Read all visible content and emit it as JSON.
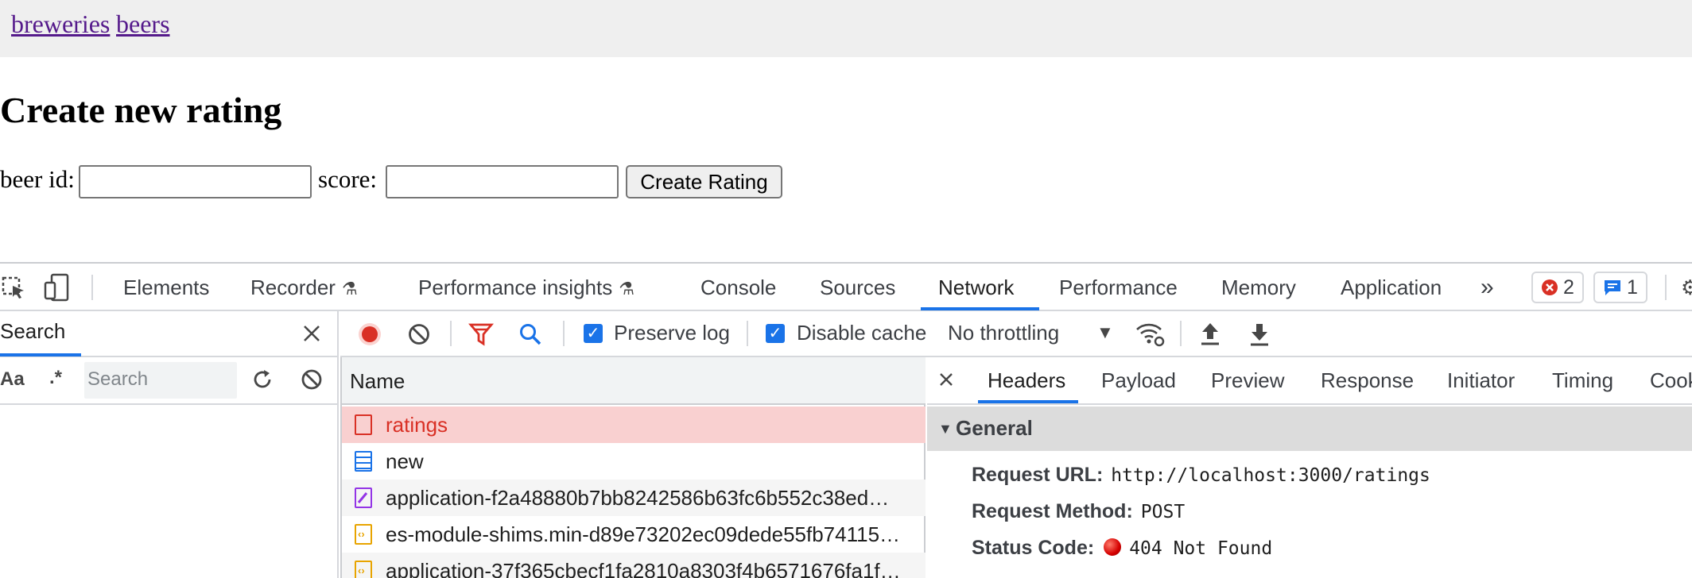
{
  "page": {
    "nav_links": [
      "breweries",
      "beers"
    ],
    "title": "Create new rating",
    "form": {
      "beer_id_label": "beer id:",
      "score_label": "score:",
      "beer_id_value": "",
      "score_value": "",
      "submit_label": "Create Rating"
    }
  },
  "devtools": {
    "tabs": [
      "Elements",
      "Recorder",
      "Performance insights",
      "Console",
      "Sources",
      "Network",
      "Performance",
      "Memory",
      "Application"
    ],
    "active_tab": "Network",
    "error_count": "2",
    "message_count": "1",
    "search_panel": {
      "title": "Search",
      "case_label": "Aa",
      "regex_label": ".*",
      "placeholder": "Search"
    },
    "network_toolbar": {
      "preserve_log": "Preserve log",
      "disable_cache": "Disable cache",
      "throttling": "No throttling"
    },
    "requests": {
      "column": "Name",
      "rows": [
        {
          "name": "ratings",
          "type": "error"
        },
        {
          "name": "new",
          "type": "document"
        },
        {
          "name": "application-f2a48880b7bb8242586b63fc6b552c38ed…",
          "type": "stylesheet"
        },
        {
          "name": "es-module-shims.min-d89e73202ec09dede55fb74115…",
          "type": "script"
        },
        {
          "name": "application-37f365cbecf1fa2810a8303f4b6571676fa1f…",
          "type": "script"
        }
      ]
    },
    "detail": {
      "tabs": [
        "Headers",
        "Payload",
        "Preview",
        "Response",
        "Initiator",
        "Timing",
        "Cooki"
      ],
      "active_tab": "Headers",
      "section": "General",
      "fields": [
        {
          "key": "Request URL:",
          "value": "http://localhost:3000/ratings"
        },
        {
          "key": "Request Method:",
          "value": "POST"
        },
        {
          "key": "Status Code:",
          "value": "404 Not Found"
        }
      ]
    },
    "colors": {
      "accent": "#1a73e8",
      "error_text": "#d93025",
      "error_row": "#f9d0d0"
    }
  }
}
